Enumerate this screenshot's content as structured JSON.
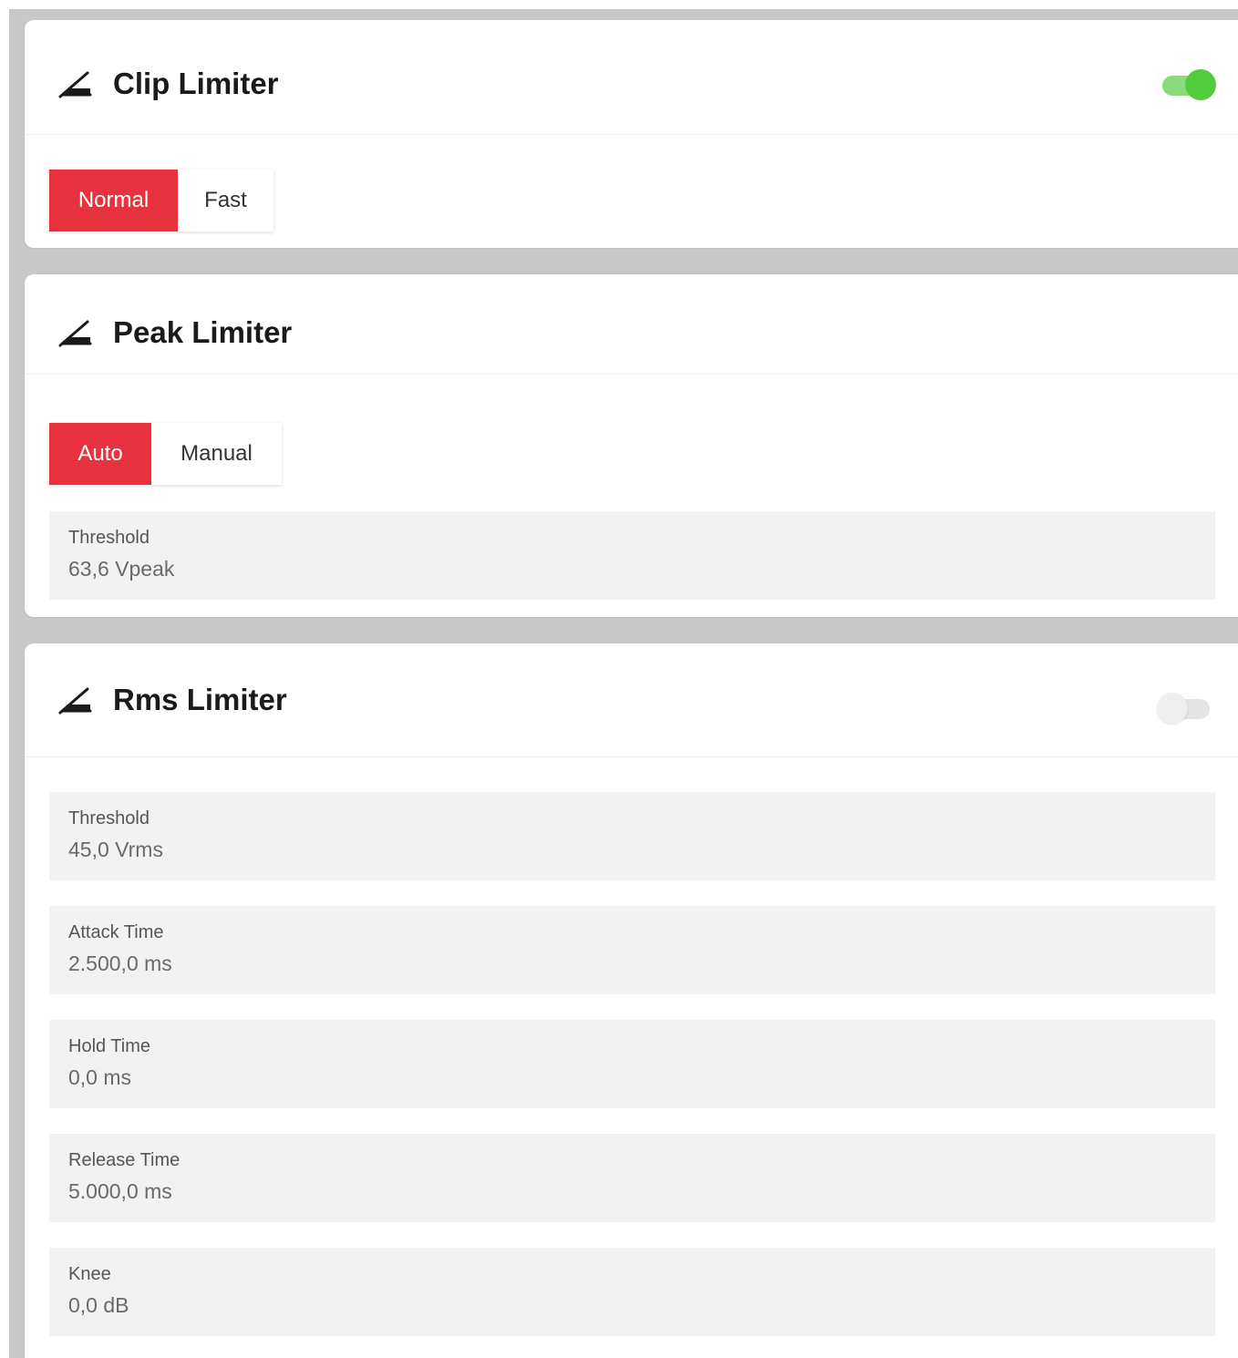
{
  "clip_limiter": {
    "title": "Clip Limiter",
    "icon": "limiter-icon",
    "enabled": true,
    "modes": [
      "Normal",
      "Fast"
    ],
    "selected_mode": "Normal"
  },
  "peak_limiter": {
    "title": "Peak Limiter",
    "icon": "limiter-icon",
    "modes": [
      "Auto",
      "Manual"
    ],
    "selected_mode": "Auto",
    "params": [
      {
        "label": "Threshold",
        "value": "63,6 Vpeak"
      }
    ]
  },
  "rms_limiter": {
    "title": "Rms Limiter",
    "icon": "limiter-icon",
    "enabled": false,
    "params": [
      {
        "label": "Threshold",
        "value": "45,0 Vrms"
      },
      {
        "label": "Attack Time",
        "value": "2.500,0 ms"
      },
      {
        "label": "Hold Time",
        "value": "0,0 ms"
      },
      {
        "label": "Release Time",
        "value": "5.000,0 ms"
      },
      {
        "label": "Knee",
        "value": "0,0 dB"
      }
    ]
  },
  "colors": {
    "accent": "#e8323f",
    "toggle_on": "#52cc3c",
    "toggle_off": "#e4e4e4",
    "background": "#c8c8c8",
    "field": "#f2f2f2"
  }
}
